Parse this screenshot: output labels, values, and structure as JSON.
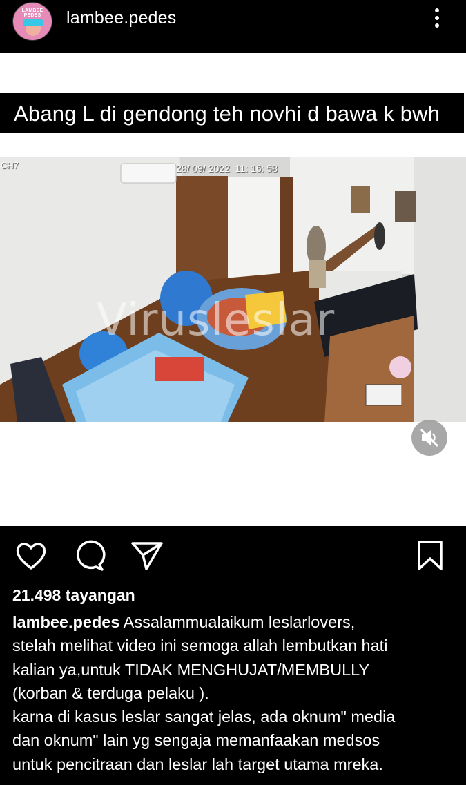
{
  "header": {
    "avatar_text": "LAMBEE PEDES",
    "username": "lambee.pedes"
  },
  "post": {
    "caption_overlay": "Abang L di gendong teh novhi d bawa k bwh",
    "cctv": {
      "channel": "CH7",
      "timestamp": "28/ 09/ 2022  11: 16: 58",
      "watermark": "Virusleslar"
    }
  },
  "actions": {
    "like": "heart-icon",
    "comment": "comment-icon",
    "share": "send-icon",
    "save": "bookmark-icon",
    "mute": "muted-speaker-icon"
  },
  "stats": {
    "views": "21.498 tayangan"
  },
  "caption": {
    "author": "lambee.pedes",
    "lines": [
      "Assalammualaikum leslarlovers,",
      "stelah melihat video ini semoga allah lembutkan hati",
      "kalian ya,untuk TIDAK MENGHUJAT/MEMBULLY",
      "(korban & terduga pelaku ).",
      "karna di kasus leslar sangat jelas, ada oknum\" media",
      "dan oknum\" lain yg sengaja memanfaakan medsos",
      "untuk pencitraan dan leslar lah target utama mreka."
    ]
  },
  "colors": {
    "background": "#000000",
    "post_background": "#ffffff",
    "text": "#ffffff",
    "avatar_pink": "#e68ab8"
  }
}
